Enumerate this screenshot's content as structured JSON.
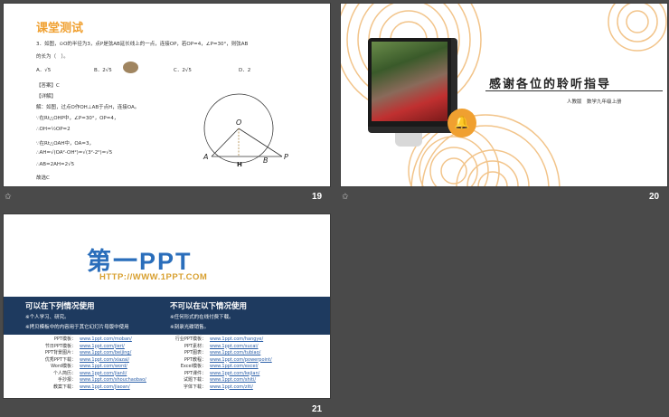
{
  "slides": [
    {
      "num": "19",
      "title": "课堂测试",
      "question_line1": "3．如图，⊙O的半径为3，点P是弦AB延长线上的一点，连接OP，若OP=4，∠P=30°，则弦AB",
      "question_line2": "的长为（　）。",
      "opt_a": "A．√5",
      "opt_b": "B．2√5",
      "opt_c": "C．2√5",
      "opt_d": "D．2",
      "answer": "【答案】C",
      "detail": "【详解】",
      "sol1": "解：如图，过点O作OH⊥AB于点H，连接OA。",
      "sol2": "∵在Rt△OHP中，∠P=30°，OP=4，",
      "sol3": "∴OH=½OP=2",
      "sol4": "∵在Rt△OAH中，OA=3，",
      "sol5": "∴AH=√(OA²-OH²)=√(3²-2²)=√5",
      "sol6": "∴AB=2AH=2√5",
      "sol7": "故选C",
      "diagram": {
        "O": "O",
        "A": "A",
        "H": "H",
        "B": "B",
        "P": "P"
      }
    },
    {
      "num": "20",
      "thanks": "感谢各位的聆听指导",
      "subtitle": "人教版　数学九年级上册"
    },
    {
      "num": "21",
      "logo": "第一PPT",
      "url": "HTTP://WWW.1PPT.COM",
      "can_title": "可以在下列情况使用",
      "cannot_title": "不可以在以下情况使用",
      "can_items": [
        "※个人学习、研究。",
        "※拷贝模板中的内容用于其它幻灯片母版中使用"
      ],
      "cannot_items": [
        "※任何形式的在线付费下载。",
        "※刻录光碟销售。"
      ],
      "links_left": [
        {
          "label": "PPT模板：",
          "url": "www.1ppt.com/moban/"
        },
        {
          "label": "节日PPT模板：",
          "url": "www.1ppt.com/jieri/"
        },
        {
          "label": "PPT背景图片：",
          "url": "www.1ppt.com/beijing/"
        },
        {
          "label": "优秀PPT下载：",
          "url": "www.1ppt.com/xiazai/"
        },
        {
          "label": "Word模板：",
          "url": "www.1ppt.com/word/"
        },
        {
          "label": "个人简历：",
          "url": "www.1ppt.com/jianli/"
        },
        {
          "label": "手抄报：",
          "url": "www.1ppt.com/shouchaobao/"
        },
        {
          "label": "教案下载：",
          "url": "www.1ppt.com/jiaoan/"
        }
      ],
      "links_right": [
        {
          "label": "行业PPT模板：",
          "url": "www.1ppt.com/hangye/"
        },
        {
          "label": "PPT素材：",
          "url": "www.1ppt.com/sucai/"
        },
        {
          "label": "PPT图表：",
          "url": "www.1ppt.com/tubiao/"
        },
        {
          "label": "PPT教程：",
          "url": "www.1ppt.com/powerpoint/"
        },
        {
          "label": "Excel模板：",
          "url": "www.1ppt.com/excel/"
        },
        {
          "label": "PPT课件：",
          "url": "www.1ppt.com/kejian/"
        },
        {
          "label": "试题下载：",
          "url": "www.1ppt.com/shiti/"
        },
        {
          "label": "字体下载：",
          "url": "www.1ppt.com/ziti/"
        }
      ]
    }
  ],
  "colors": {
    "orange": "#f0a030",
    "navy": "#1e3a5f",
    "logo_blue": "#2a6ebb"
  }
}
